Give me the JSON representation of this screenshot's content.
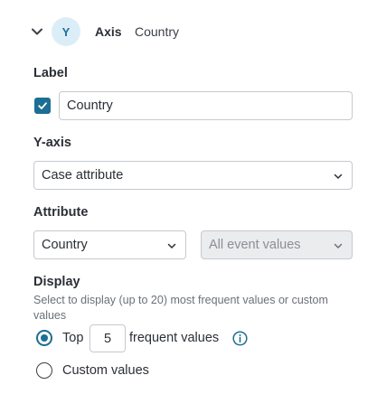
{
  "header": {
    "badge": "Y",
    "title": "Axis",
    "subtitle": "Country"
  },
  "label_section": {
    "heading": "Label",
    "checked": true,
    "value": "Country"
  },
  "yaxis_section": {
    "heading": "Y-axis",
    "selected": "Case attribute"
  },
  "attribute_section": {
    "heading": "Attribute",
    "attribute_selected": "Country",
    "values_selected": "All event values"
  },
  "display_section": {
    "heading": "Display",
    "description": "Select to display (up to 20) most frequent values or custom values",
    "option_top_prefix": "Top",
    "top_count": "5",
    "option_top_suffix": "frequent values",
    "option_custom": "Custom values",
    "selected_option": "top"
  },
  "colors": {
    "accent": "#1c6e94",
    "badge_bg": "#dbeef8"
  },
  "icons": {
    "collapse": "chevron-down-icon",
    "check": "check-icon",
    "dropdown": "chevron-down-icon",
    "info": "info-icon"
  }
}
